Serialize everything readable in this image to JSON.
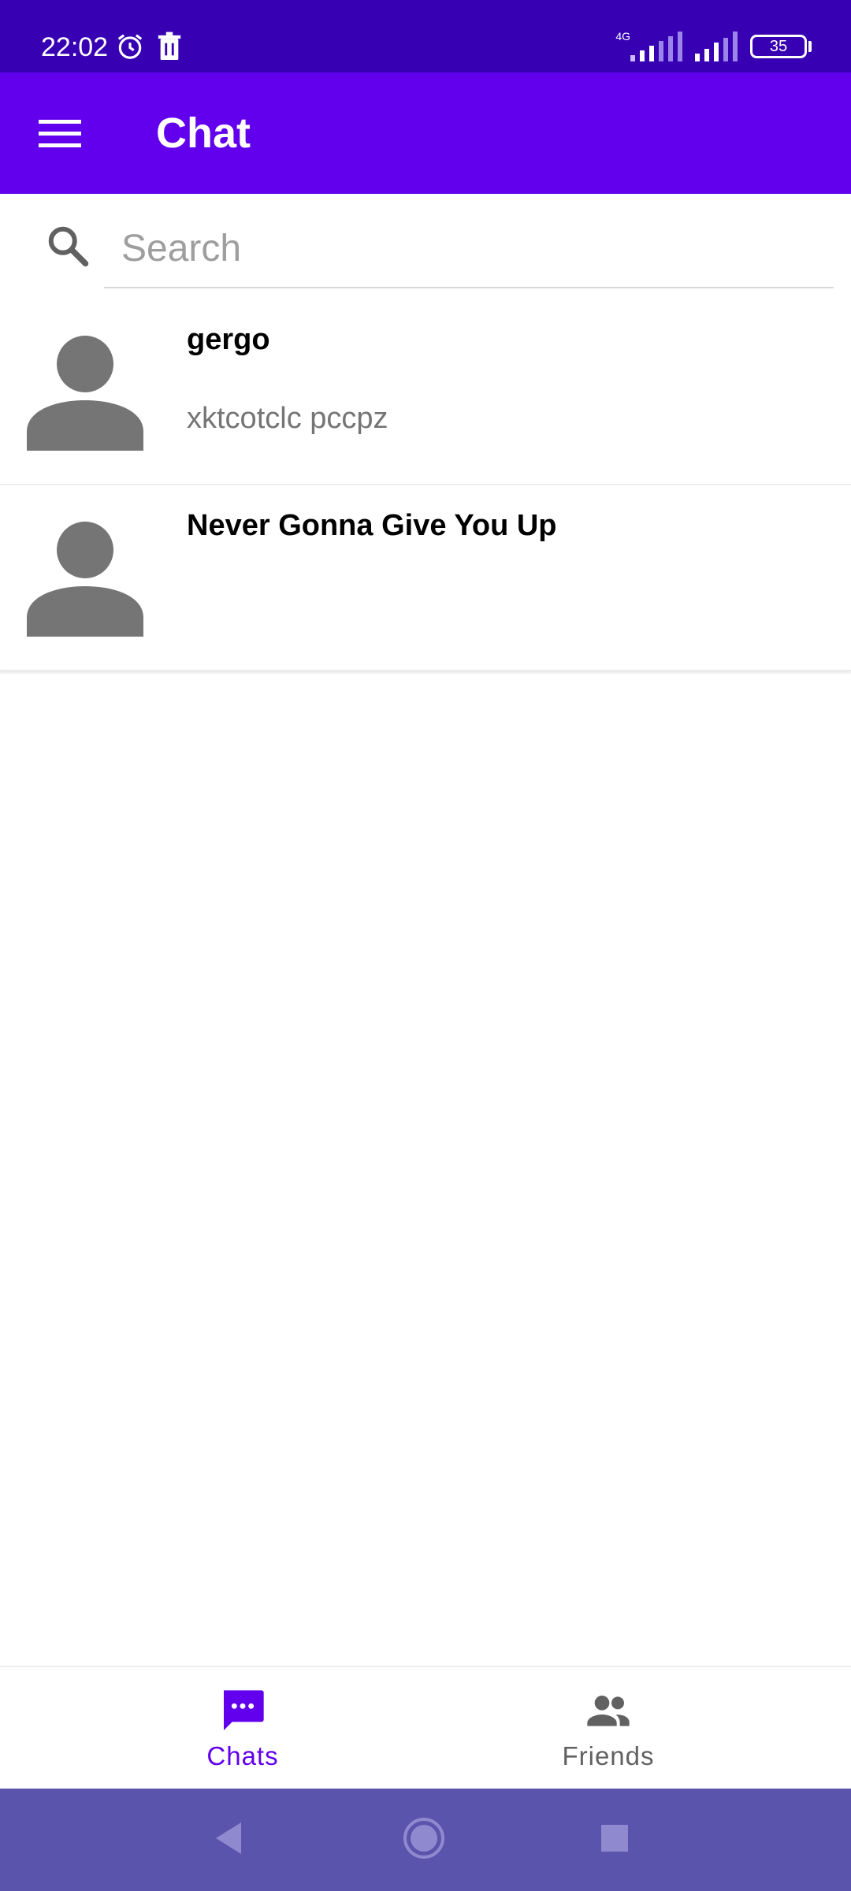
{
  "status_bar": {
    "time": "22:02",
    "network": "4G",
    "battery": "35"
  },
  "app_bar": {
    "title": "Chat"
  },
  "search": {
    "placeholder": "Search"
  },
  "chats": [
    {
      "name": "gergo",
      "preview": "xktcotclc pccpz"
    },
    {
      "name": "Never Gonna Give You Up",
      "preview": ""
    }
  ],
  "bottom_nav": {
    "items": [
      {
        "label": "Chats",
        "icon": "chat-bubble-icon",
        "active": true
      },
      {
        "label": "Friends",
        "icon": "people-icon",
        "active": false
      }
    ]
  },
  "colors": {
    "status_bar": "#3700b3",
    "primary": "#6200ee",
    "system_nav": "#5a54ad",
    "inactive": "#616161",
    "avatar": "#757575"
  }
}
